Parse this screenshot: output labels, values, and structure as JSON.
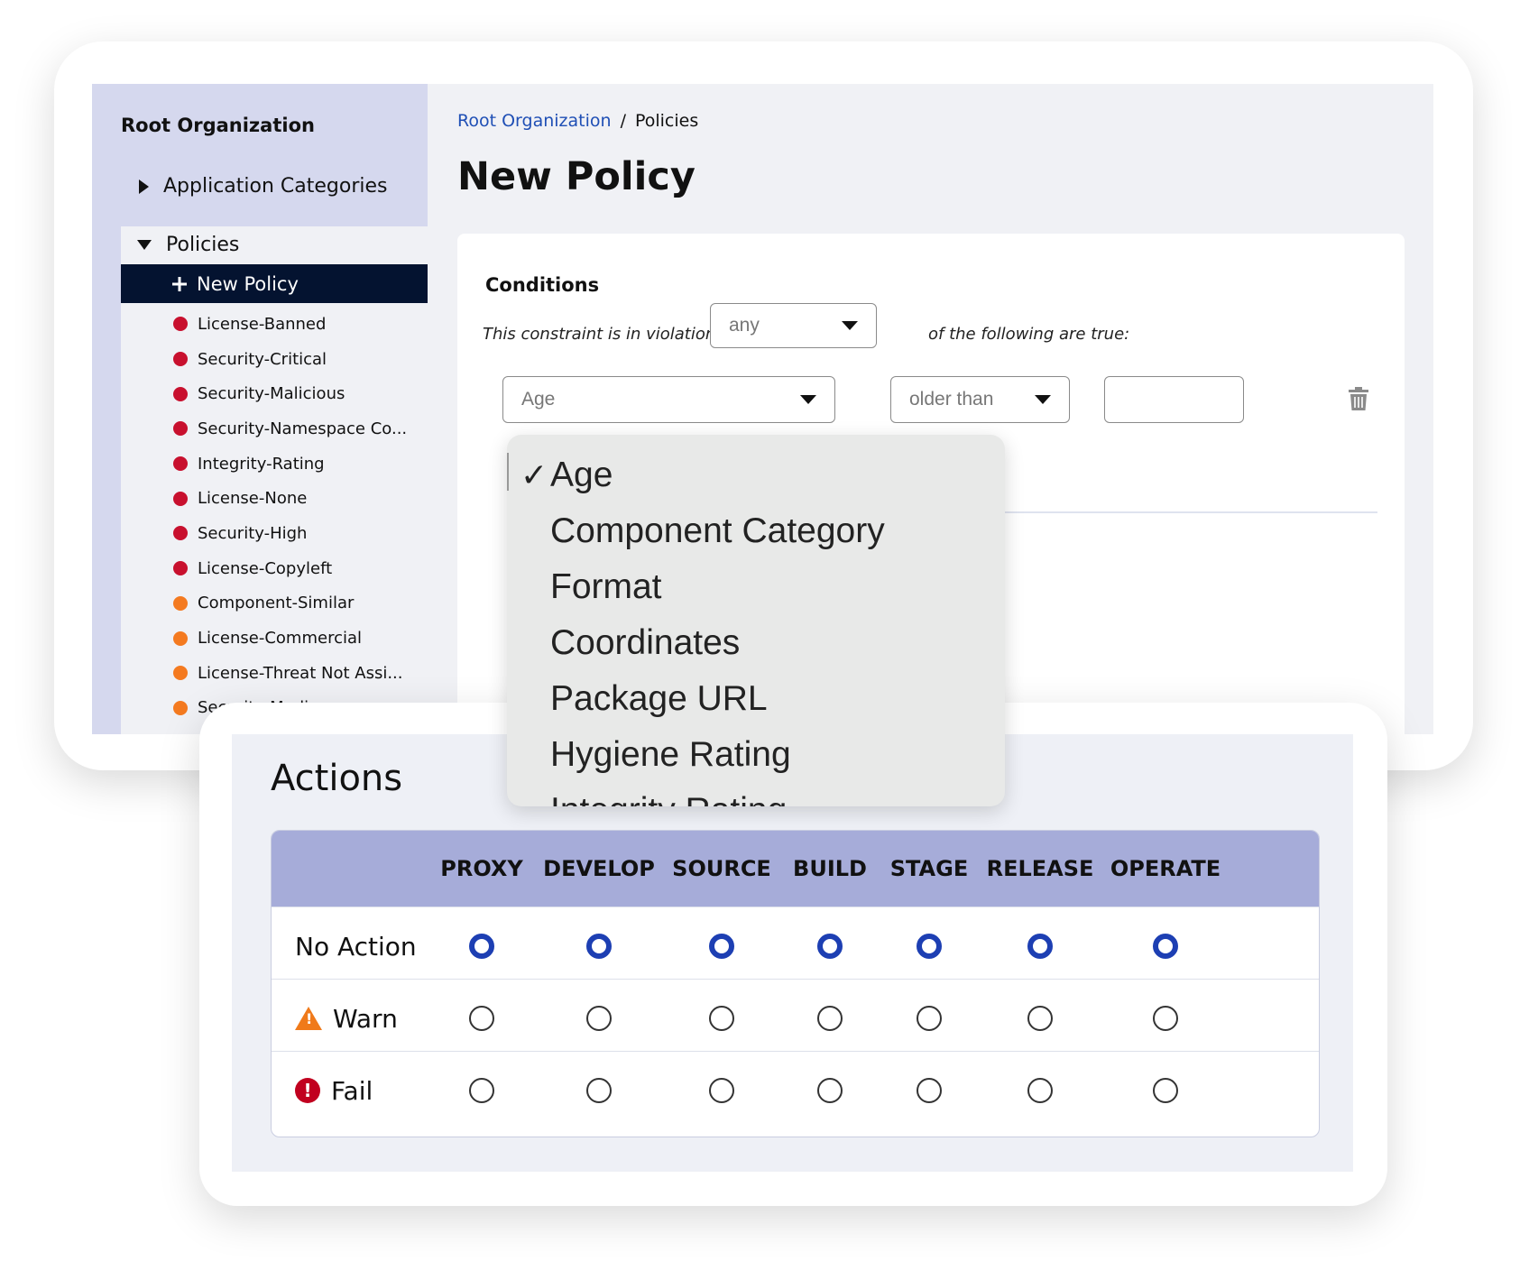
{
  "sidebar": {
    "org_title": "Root Organization",
    "category_label": "Application Categories",
    "policies_label": "Policies",
    "new_policy_label": "New Policy",
    "items": [
      {
        "label": "License-Banned",
        "color": "#c8102e"
      },
      {
        "label": "Security-Critical",
        "color": "#c8102e"
      },
      {
        "label": "Security-Malicious",
        "color": "#c8102e"
      },
      {
        "label": "Security-Namespace Co...",
        "color": "#c8102e"
      },
      {
        "label": "Integrity-Rating",
        "color": "#c8102e"
      },
      {
        "label": "License-None",
        "color": "#c8102e"
      },
      {
        "label": "Security-High",
        "color": "#c8102e"
      },
      {
        "label": "License-Copyleft",
        "color": "#c8102e"
      },
      {
        "label": "Component-Similar",
        "color": "#f47a20"
      },
      {
        "label": "License-Commercial",
        "color": "#f47a20"
      },
      {
        "label": "License-Threat Not Assi...",
        "color": "#f47a20"
      },
      {
        "label": "Security-Medium",
        "color": "#f47a20"
      }
    ]
  },
  "breadcrumb": {
    "root": "Root Organization",
    "separator": "/",
    "current": "Policies"
  },
  "page_title": "New Policy",
  "conditions": {
    "title": "Conditions",
    "prefix": "This constraint is in violation if",
    "match_value": "any",
    "suffix": "of the following are true:",
    "condition_field": "Age",
    "operator": "older than",
    "value": ""
  },
  "dropdown": {
    "selected": "Age",
    "options": [
      "Age",
      "Component Category",
      "Format",
      "Coordinates",
      "Package URL",
      "Hygiene Rating",
      "Integrity Rating"
    ]
  },
  "actions": {
    "title": "Actions",
    "stages": [
      "PROXY",
      "DEVELOP",
      "SOURCE",
      "BUILD",
      "STAGE",
      "RELEASE",
      "OPERATE"
    ],
    "rows": [
      {
        "label": "No Action",
        "icon": "none",
        "selected": true
      },
      {
        "label": "Warn",
        "icon": "warning-icon",
        "selected": false
      },
      {
        "label": "Fail",
        "icon": "fail-icon",
        "selected": false
      }
    ]
  },
  "colors": {
    "accent": "#1d3fb3",
    "link": "#1f4fb5",
    "sidebar": "#d5d8ee",
    "active_nav": "#041330",
    "table_header": "#a6acd9",
    "critical": "#c8102e",
    "medium": "#f47a20"
  }
}
